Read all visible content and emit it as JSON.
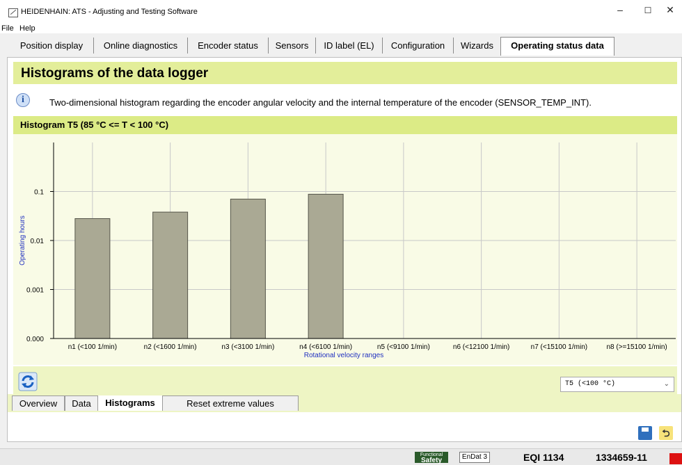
{
  "window": {
    "title": "HEIDENHAIN: ATS - Adjusting and Testing Software"
  },
  "menu": {
    "file": "File",
    "help": "Help"
  },
  "tabs": [
    {
      "label": "Position display"
    },
    {
      "label": "Online diagnostics"
    },
    {
      "label": "Encoder status"
    },
    {
      "label": "Sensors"
    },
    {
      "label": "ID label (EL)"
    },
    {
      "label": "Configuration"
    },
    {
      "label": "Wizards"
    },
    {
      "label": "Operating status data",
      "active": true
    }
  ],
  "panel": {
    "title": "Histograms of the data logger",
    "info": "Two-dimensional histogram regarding the encoder angular velocity and the  internal temperature of the encoder (SENSOR_TEMP_INT).",
    "histogram_title": "Histogram T5 (85 °C <= T < 100 °C)"
  },
  "chart_data": {
    "type": "bar",
    "yscale": "log",
    "title": "",
    "xlabel": "Rotational velocity ranges",
    "ylabel": "Operating hours",
    "ylim": [
      0.0001,
      1
    ],
    "yticks": [
      "0.000",
      "0.001",
      "0.01",
      "0.1"
    ],
    "categories": [
      "n1 (<100 1/min)",
      "n2 (<1600 1/min)",
      "n3 (<3100 1/min)",
      "n4 (<6100 1/min)",
      "n5 (<9100 1/min)",
      "n6 (<12100 1/min)",
      "n7 (<15100 1/min)",
      "n8 (>=15100 1/min)"
    ],
    "values": [
      0.028,
      0.038,
      0.07,
      0.088,
      0,
      0,
      0,
      0
    ],
    "colors": {
      "bar": "#aaa994",
      "bar_edge": "#55554a",
      "background": "#f9fbe6",
      "grid": "#c8c8c8",
      "axis_label": "#1f2fbf"
    }
  },
  "temperature_select": {
    "value": "T5 (<100 °C)"
  },
  "subtabs": [
    {
      "label": "Overview"
    },
    {
      "label": "Data"
    },
    {
      "label": "Histograms",
      "active": true
    },
    {
      "label": "Reset extreme values"
    }
  ],
  "status": {
    "badge_top": "Functional",
    "badge_bottom": "Safety",
    "endat": "EnDat 3",
    "model": "EQI 1134",
    "serial": "1334659-11"
  },
  "icons": {
    "refresh": "refresh-icon",
    "save": "save-icon",
    "back": "back-icon",
    "info": "info-icon"
  }
}
